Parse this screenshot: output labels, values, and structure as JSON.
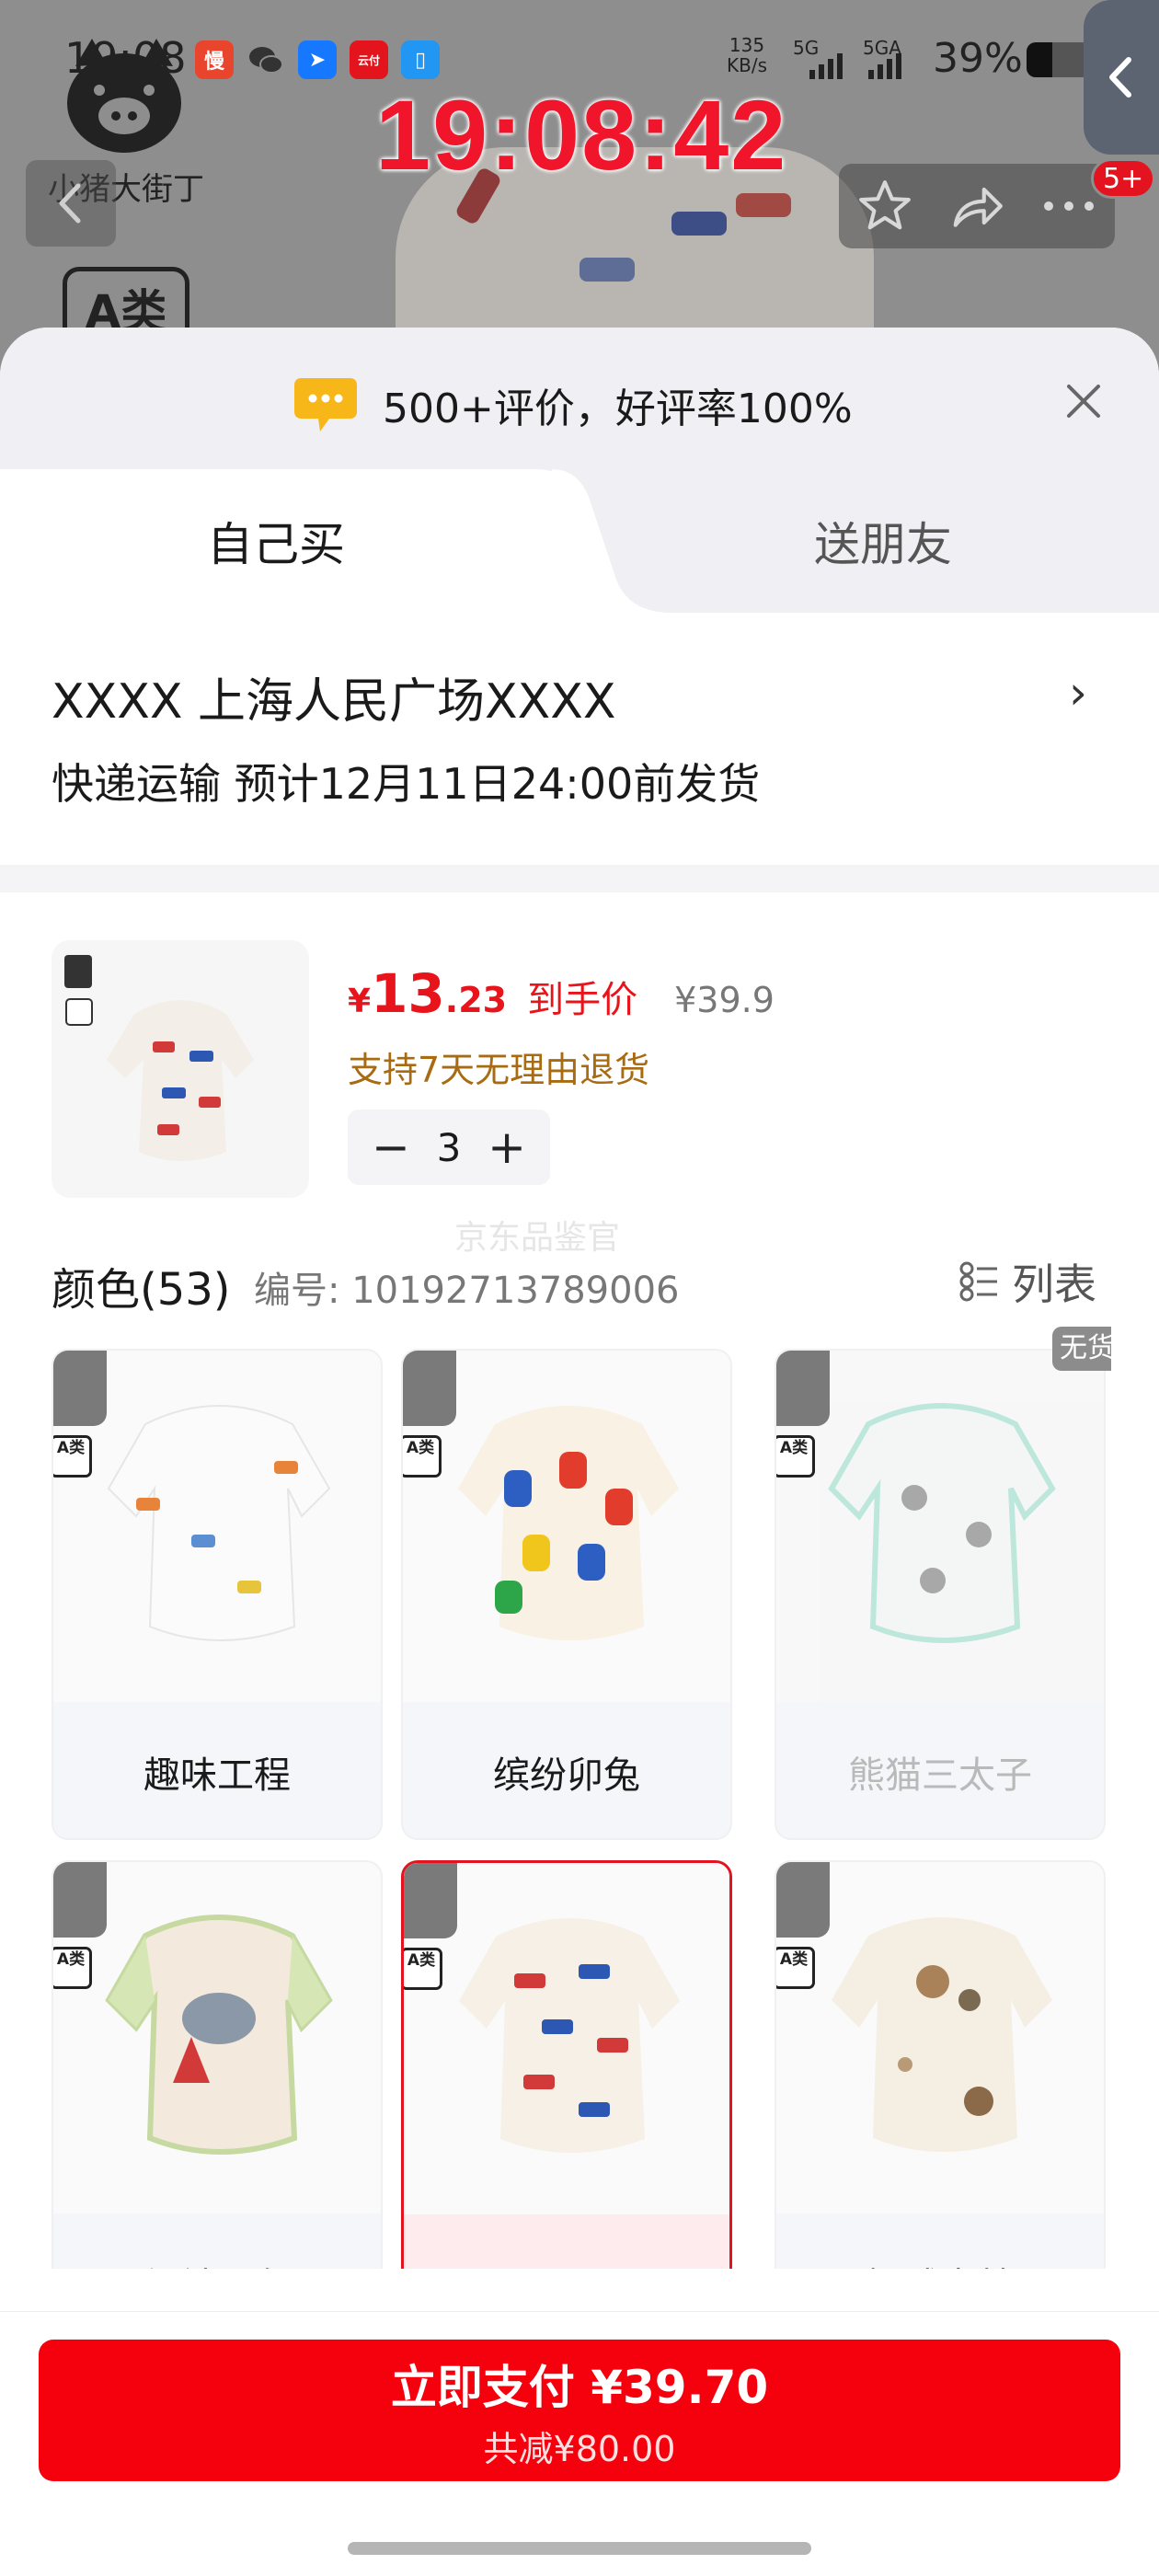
{
  "status_bar": {
    "time": "19:08",
    "net_speed_value": "135",
    "net_speed_unit": "KB/s",
    "signal1": "5G",
    "signal2": "5GA",
    "battery": "39%"
  },
  "clock_overlay": "19:08:42",
  "product_bg": {
    "brand_text": "小猪大街丁",
    "grade": "A类"
  },
  "header": {
    "cart_badge": "5+"
  },
  "sheet": {
    "rating": "500+评价，好评率100%",
    "tabs": [
      {
        "label": "自己买",
        "active": true
      },
      {
        "label": "送朋友",
        "active": false
      }
    ],
    "address": "XXXX  上海人民广场XXXX",
    "shipping": "快递运输 预计12月11日24:00前发货"
  },
  "product": {
    "price_symbol": "¥",
    "price_int": "13",
    "price_dec": ".23",
    "price_label": "到手价",
    "original_price": "¥39.9",
    "return_policy": "支持7天无理由退货",
    "quantity": "3",
    "minus": "−",
    "plus": "+",
    "watermark": "京东品鉴官"
  },
  "color_section": {
    "title": "颜色(53)",
    "sku": "编号: 10192713789006",
    "view_toggle": "列表",
    "sold_out_tag": "无货",
    "items": [
      {
        "label": "趣味工程",
        "selected": false,
        "disabled": false
      },
      {
        "label": "缤纷卯兔",
        "selected": false,
        "disabled": false
      },
      {
        "label": "熊猫三太子",
        "selected": false,
        "disabled": true
      },
      {
        "label": "绿袖小象",
        "selected": false,
        "disabled": false
      },
      {
        "label": "大卡车",
        "selected": true,
        "disabled": false
      },
      {
        "label": "挪威森林",
        "selected": false,
        "disabled": false
      }
    ],
    "grade_label": "A类"
  },
  "checkout": {
    "pay_label": "立即支付 ¥39.70",
    "discount_label": "共减¥80.00"
  }
}
